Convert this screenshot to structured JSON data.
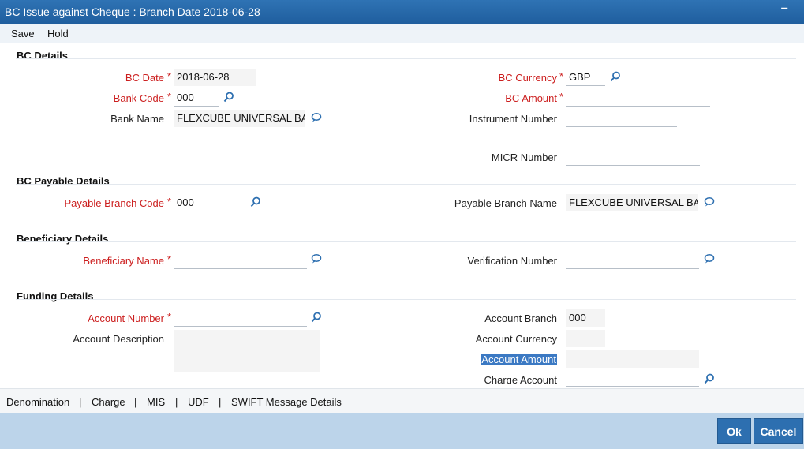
{
  "window": {
    "title": "BC Issue against Cheque : Branch Date 2018-06-28",
    "minimize": "−"
  },
  "toolbar": {
    "save": "Save",
    "hold": "Hold"
  },
  "sections": {
    "bc_details": "BC Details",
    "payable": "BC Payable Details",
    "beneficiary": "Beneficiary Details",
    "funding": "Funding Details"
  },
  "required_marker": "*",
  "fields": {
    "bc_date": {
      "label": "BC Date",
      "value": "2018-06-28"
    },
    "bank_code": {
      "label": "Bank Code",
      "value": "000"
    },
    "bank_name": {
      "label": "Bank Name",
      "value": "FLEXCUBE UNIVERSAL BA"
    },
    "bc_currency": {
      "label": "BC Currency",
      "value": "GBP"
    },
    "bc_amount": {
      "label": "BC Amount",
      "value": ""
    },
    "instrument_number": {
      "label": "Instrument Number",
      "value": ""
    },
    "micr_number": {
      "label": "MICR Number",
      "value": ""
    },
    "payable_branch_code": {
      "label": "Payable Branch Code",
      "value": "000"
    },
    "payable_branch_name": {
      "label": "Payable Branch Name",
      "value": "FLEXCUBE UNIVERSAL BA"
    },
    "beneficiary_name": {
      "label": "Beneficiary Name",
      "value": ""
    },
    "verification_number": {
      "label": "Verification Number",
      "value": ""
    },
    "account_number": {
      "label": "Account Number",
      "value": ""
    },
    "account_description": {
      "label": "Account Description",
      "value": ""
    },
    "account_branch": {
      "label": "Account Branch",
      "value": "000"
    },
    "account_currency": {
      "label": "Account Currency",
      "value": ""
    },
    "account_amount": {
      "label": "Account Amount",
      "value": ""
    },
    "charge_account": {
      "label": "Charge Account",
      "value": ""
    }
  },
  "tabs": [
    "Denomination",
    "|",
    "Charge",
    "|",
    "MIS",
    "|",
    "UDF",
    "|",
    "SWIFT Message Details"
  ],
  "buttons": {
    "ok": "Ok",
    "cancel": "Cancel"
  },
  "colors": {
    "accent": "#2d6fb0",
    "required": "#cc1f1f",
    "footer": "#bcd4ea"
  }
}
